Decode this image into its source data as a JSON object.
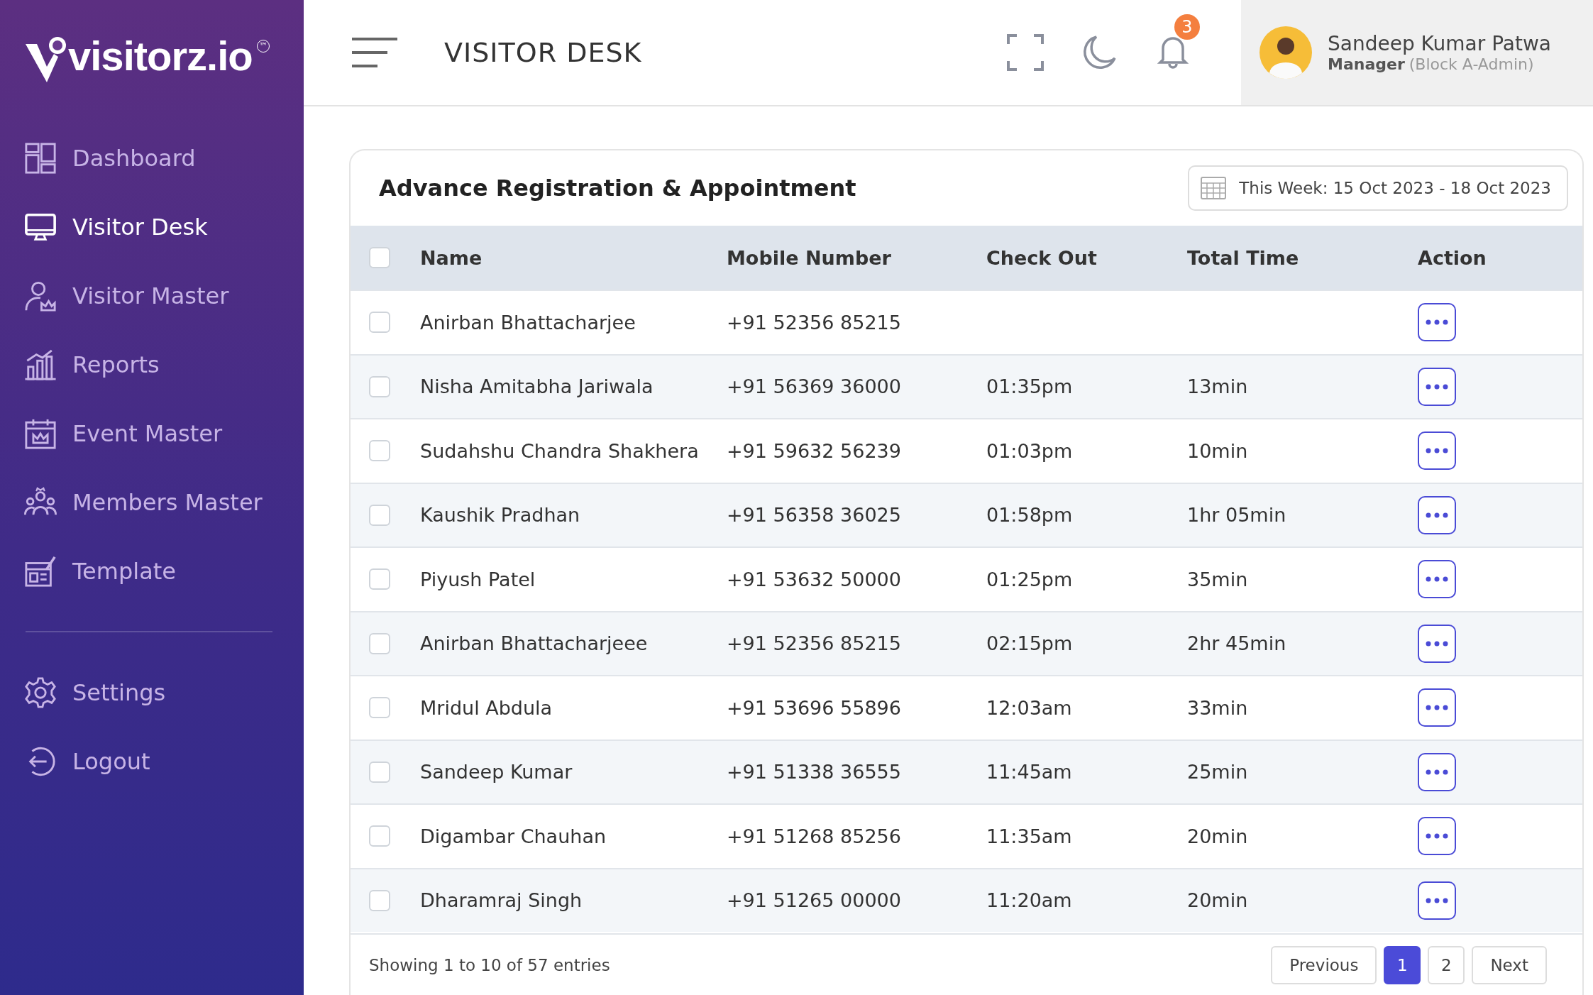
{
  "sidebar": {
    "logo": "visitorz.io",
    "trademark": "™",
    "items": [
      {
        "label": "Dashboard",
        "selected": false
      },
      {
        "label": "Visitor Desk",
        "selected": true
      },
      {
        "label": "Visitor Master",
        "selected": false
      },
      {
        "label": "Reports",
        "selected": false
      },
      {
        "label": "Event Master",
        "selected": false
      },
      {
        "label": "Members Master",
        "selected": false
      },
      {
        "label": "Template",
        "selected": false
      }
    ],
    "bottom_items": [
      {
        "label": "Settings",
        "selected": false
      },
      {
        "label": "Logout",
        "selected": false
      }
    ]
  },
  "header": {
    "title": "VISITOR DESK",
    "notification_count": "3",
    "user": {
      "name": "Sandeep Kumar Patwa",
      "role": "Manager",
      "block": "(Block A-Admin)"
    }
  },
  "card": {
    "title": "Advance Registration & Appointment",
    "date_range": "This Week: 15 Oct 2023 - 18 Oct 2023"
  },
  "table": {
    "all_checked": false,
    "columns": [
      "Name",
      "Mobile Number",
      "Check Out",
      "Total Time",
      "Action"
    ],
    "rows": [
      {
        "checked": false,
        "name": "Anirban Bhattacharjee",
        "mobile": "+91 52356 85215",
        "check_out": "",
        "total_time": ""
      },
      {
        "checked": false,
        "name": "Nisha Amitabha Jariwala",
        "mobile": "+91 56369 36000",
        "check_out": "01:35pm",
        "total_time": "13min"
      },
      {
        "checked": false,
        "name": "Sudahshu Chandra Shakhera",
        "mobile": "+91 59632 56239",
        "check_out": "01:03pm",
        "total_time": "10min"
      },
      {
        "checked": false,
        "name": "Kaushik Pradhan",
        "mobile": "+91 56358 36025",
        "check_out": "01:58pm",
        "total_time": "1hr 05min"
      },
      {
        "checked": false,
        "name": "Piyush Patel",
        "mobile": "+91 53632 50000",
        "check_out": "01:25pm",
        "total_time": "35min"
      },
      {
        "checked": false,
        "name": "Anirban Bhattacharjeee",
        "mobile": "+91 52356 85215",
        "check_out": "02:15pm",
        "total_time": "2hr 45min"
      },
      {
        "checked": false,
        "name": "Mridul Abdula",
        "mobile": "+91 53696 55896",
        "check_out": "12:03am",
        "total_time": "33min"
      },
      {
        "checked": false,
        "name": "Sandeep Kumar",
        "mobile": "+91 51338 36555",
        "check_out": "11:45am",
        "total_time": "25min"
      },
      {
        "checked": false,
        "name": "Digambar Chauhan",
        "mobile": "+91 51268 85256",
        "check_out": "11:35am",
        "total_time": "20min"
      },
      {
        "checked": false,
        "name": "Dharamraj Singh",
        "mobile": "+91 51265 00000",
        "check_out": "11:20am",
        "total_time": "20min"
      }
    ]
  },
  "footer": {
    "summary": "Showing 1 to 10 of 57 entries",
    "previous": "Previous",
    "pages": [
      {
        "label": "1",
        "selected": true
      },
      {
        "label": "2",
        "selected": false
      }
    ],
    "next": "Next"
  }
}
